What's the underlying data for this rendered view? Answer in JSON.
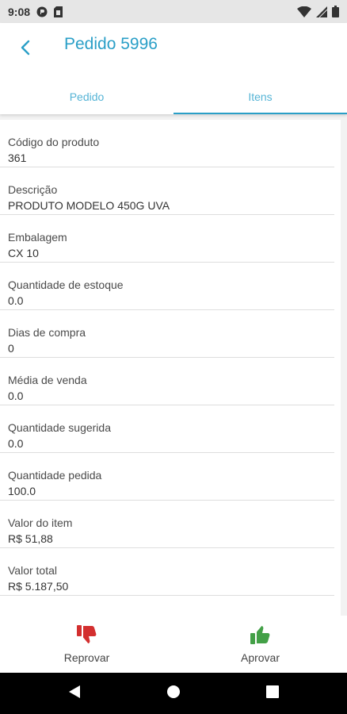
{
  "status_bar": {
    "time": "9:08",
    "icons": [
      "alert-circle-icon",
      "sim-card-icon",
      "wifi-icon",
      "signal-icon",
      "battery-icon"
    ]
  },
  "app_bar": {
    "title": "Pedido 5996",
    "back_icon": "chevron-left-icon",
    "accent_color": "#2a9fc7"
  },
  "tabs": [
    {
      "label": "Pedido",
      "active": false
    },
    {
      "label": "Itens",
      "active": true
    }
  ],
  "fields": [
    {
      "label": "Código do produto",
      "value": "361"
    },
    {
      "label": "Descrição",
      "value": "PRODUTO MODELO 450G UVA"
    },
    {
      "label": "Embalagem",
      "value": "CX 10"
    },
    {
      "label": "Quantidade de estoque",
      "value": "0.0"
    },
    {
      "label": "Dias de compra",
      "value": "0"
    },
    {
      "label": "Média de venda",
      "value": "0.0"
    },
    {
      "label": "Quantidade sugerida",
      "value": "0.0"
    },
    {
      "label": "Quantidade pedida",
      "value": "100.0"
    },
    {
      "label": "Valor do item",
      "value": "R$ 51,88"
    },
    {
      "label": "Valor total",
      "value": "R$ 5.187,50"
    }
  ],
  "actions": {
    "reject": {
      "label": "Reprovar",
      "icon": "thumbs-down-icon",
      "color": "#d32f2f"
    },
    "approve": {
      "label": "Aprovar",
      "icon": "thumbs-up-icon",
      "color": "#43a047"
    }
  },
  "nav_bar": {
    "icons": [
      "back-triangle-icon",
      "home-circle-icon",
      "recents-square-icon"
    ]
  }
}
